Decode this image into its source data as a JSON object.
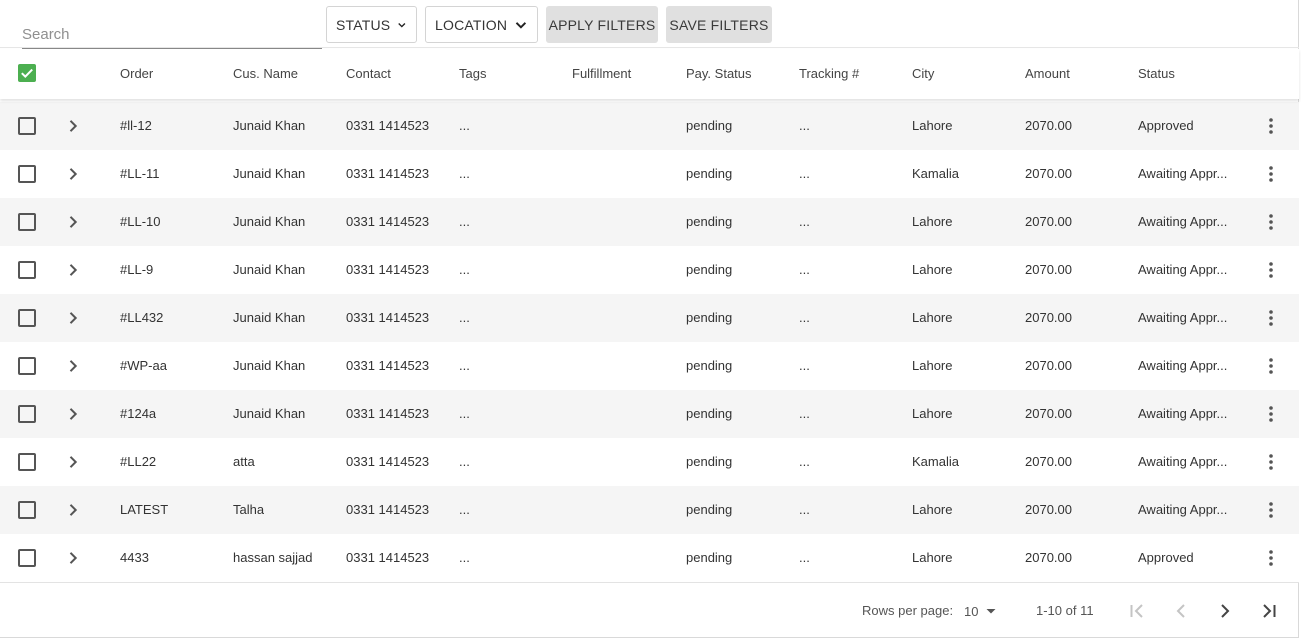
{
  "toolbar": {
    "search_placeholder": "Search",
    "status_label": "STATUS",
    "location_label": "LOCATION",
    "apply_label": "APPLY FILTERS",
    "save_label": "SAVE FILTERS"
  },
  "table": {
    "columns": [
      "Order",
      "Cus. Name",
      "Contact",
      "Tags",
      "Fulfillment",
      "Pay. Status",
      "Tracking #",
      "City",
      "Amount",
      "Status"
    ],
    "rows": [
      {
        "order": "#ll-12",
        "name": "Junaid Khan",
        "contact": "0331 1414523",
        "tags": "...",
        "fulfillment": "",
        "pay_status": "pending",
        "tracking": "...",
        "city": "Lahore",
        "amount": "2070.00",
        "status": "Approved"
      },
      {
        "order": "#LL-11",
        "name": "Junaid Khan",
        "contact": "0331 1414523",
        "tags": "...",
        "fulfillment": "",
        "pay_status": "pending",
        "tracking": "...",
        "city": "Kamalia",
        "amount": "2070.00",
        "status": "Awaiting Appr..."
      },
      {
        "order": "#LL-10",
        "name": "Junaid Khan",
        "contact": "0331 1414523",
        "tags": "...",
        "fulfillment": "",
        "pay_status": "pending",
        "tracking": "...",
        "city": "Lahore",
        "amount": "2070.00",
        "status": "Awaiting Appr..."
      },
      {
        "order": "#LL-9",
        "name": "Junaid Khan",
        "contact": "0331 1414523",
        "tags": "...",
        "fulfillment": "",
        "pay_status": "pending",
        "tracking": "...",
        "city": "Lahore",
        "amount": "2070.00",
        "status": "Awaiting Appr..."
      },
      {
        "order": "#LL432",
        "name": "Junaid Khan",
        "contact": "0331 1414523",
        "tags": "...",
        "fulfillment": "",
        "pay_status": "pending",
        "tracking": "...",
        "city": "Lahore",
        "amount": "2070.00",
        "status": "Awaiting Appr..."
      },
      {
        "order": "#WP-aa",
        "name": "Junaid Khan",
        "contact": "0331 1414523",
        "tags": "...",
        "fulfillment": "",
        "pay_status": "pending",
        "tracking": "...",
        "city": "Lahore",
        "amount": "2070.00",
        "status": "Awaiting Appr..."
      },
      {
        "order": "#124a",
        "name": "Junaid Khan",
        "contact": "0331 1414523",
        "tags": "...",
        "fulfillment": "",
        "pay_status": "pending",
        "tracking": "...",
        "city": "Lahore",
        "amount": "2070.00",
        "status": "Awaiting Appr..."
      },
      {
        "order": "#LL22",
        "name": "atta",
        "contact": "0331 1414523",
        "tags": "...",
        "fulfillment": "",
        "pay_status": "pending",
        "tracking": "...",
        "city": "Kamalia",
        "amount": "2070.00",
        "status": "Awaiting Appr..."
      },
      {
        "order": "LATEST",
        "name": "Talha",
        "contact": "0331 1414523",
        "tags": "...",
        "fulfillment": "",
        "pay_status": "pending",
        "tracking": "...",
        "city": "Lahore",
        "amount": "2070.00",
        "status": "Awaiting Appr..."
      },
      {
        "order": "4433",
        "name": "hassan sajjad",
        "contact": "0331 1414523",
        "tags": "...",
        "fulfillment": "",
        "pay_status": "pending",
        "tracking": "...",
        "city": "Lahore",
        "amount": "2070.00",
        "status": "Approved"
      }
    ]
  },
  "pagination": {
    "rows_per_page_label": "Rows per page:",
    "rows_per_page": "10",
    "range": "1-10 of 11"
  },
  "colors": {
    "checkbox_checked": "#4caf50",
    "row_stripe": "#f5f5f5",
    "button_filled": "#e0e0e0"
  },
  "icons": {
    "header_checkbox": "checkbox-checked-icon",
    "row_checkbox": "checkbox-empty-icon",
    "expand": "chevron-right-icon",
    "row_menu": "more-vert-icon",
    "dropdown": "chevron-down-icon",
    "first_page": "first-page-icon",
    "prev_page": "chevron-left-icon",
    "next_page": "chevron-right-icon",
    "last_page": "last-page-icon"
  }
}
